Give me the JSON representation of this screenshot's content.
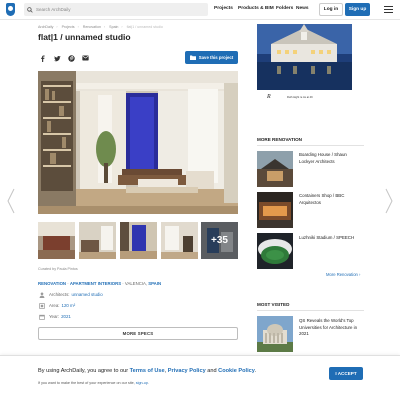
{
  "header": {
    "search_placeholder": "Search ArchDaily",
    "nav": [
      "Projects",
      "Products & BIM",
      "Folders",
      "News"
    ],
    "login": "Log in",
    "signup": "Sign up"
  },
  "breadcrumbs": [
    "ArchDaily",
    "Projects",
    "Renovation",
    "Spain",
    "flat|1 / unnamed studio"
  ],
  "project": {
    "title": "flat|1 / unnamed studio",
    "save_label": "Save this project",
    "more_photos": "+35",
    "curated_by": "Curated by Paula Pintos",
    "tag_links": [
      "RENOVATION",
      "APARTMENT INTERIORS"
    ],
    "tag_sep": " · ",
    "location_prefix": "VALENCIA,",
    "location_country": "SPAIN",
    "architects_label": "Architects:",
    "architects_value": "unnamed studio",
    "area_label": "Area:",
    "area_value": "120 m²",
    "year_label": "Year:",
    "year_value": "2021",
    "more_specs": "MORE SPECS"
  },
  "ad": {
    "brand": "Ruth Hight re tre at 49"
  },
  "sidebar": {
    "more_renovation_heading": "MORE RENOVATION",
    "items": [
      {
        "title": "Boarding House / Shaun Lockyer Architects"
      },
      {
        "title": "Containers Shop / BBC Arquitectos"
      },
      {
        "title": "Luzhniki Stadium / SPEECH"
      }
    ],
    "more_link": "More Renovation ›",
    "most_visited_heading": "MOST VISITED",
    "most_visited": [
      {
        "title": "QS Reveals the World's Top Universities for Architecture in 2021"
      }
    ]
  },
  "cookie": {
    "text_start": "By using ArchDaily, you agree to our ",
    "terms": "Terms of Use",
    "comma": ", ",
    "privacy": "Privacy Policy",
    "and": " and ",
    "cookie_policy": "Cookie Policy",
    "end": ".",
    "sub_text": "If you want to make the best of your experience on our site, ",
    "sub_link": "sign-up",
    "sub_end": ".",
    "accept": "I ACCEPT"
  },
  "colors": {
    "brand_blue": "#1f6db5",
    "text_dark": "#222222",
    "muted": "#888888"
  }
}
